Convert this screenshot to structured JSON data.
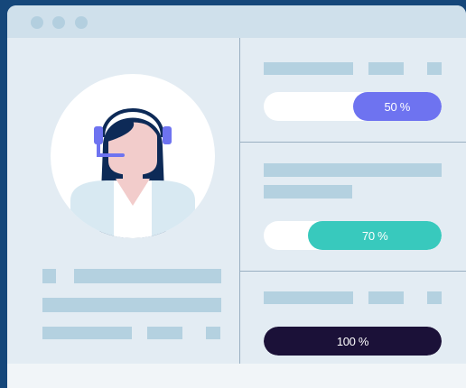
{
  "progress": [
    {
      "label": "50 %",
      "value": 0.5,
      "color": "#6e73f0"
    },
    {
      "label": "70 %",
      "value": 0.75,
      "color": "#38c9bd"
    },
    {
      "label": "100 %",
      "value": 1.0,
      "color": "#1b1138"
    }
  ],
  "colors": {
    "background": "#15477a",
    "window": "#e3ecf3",
    "titlebar": "#cfe0eb",
    "placeholder_bar": "#b4d1e0",
    "divider": "#9ab0c2",
    "headset": "#6e73f0"
  },
  "icons": {
    "avatar": "support-agent-with-headset-icon",
    "window_controls": [
      "window-dot",
      "window-dot",
      "window-dot"
    ]
  }
}
